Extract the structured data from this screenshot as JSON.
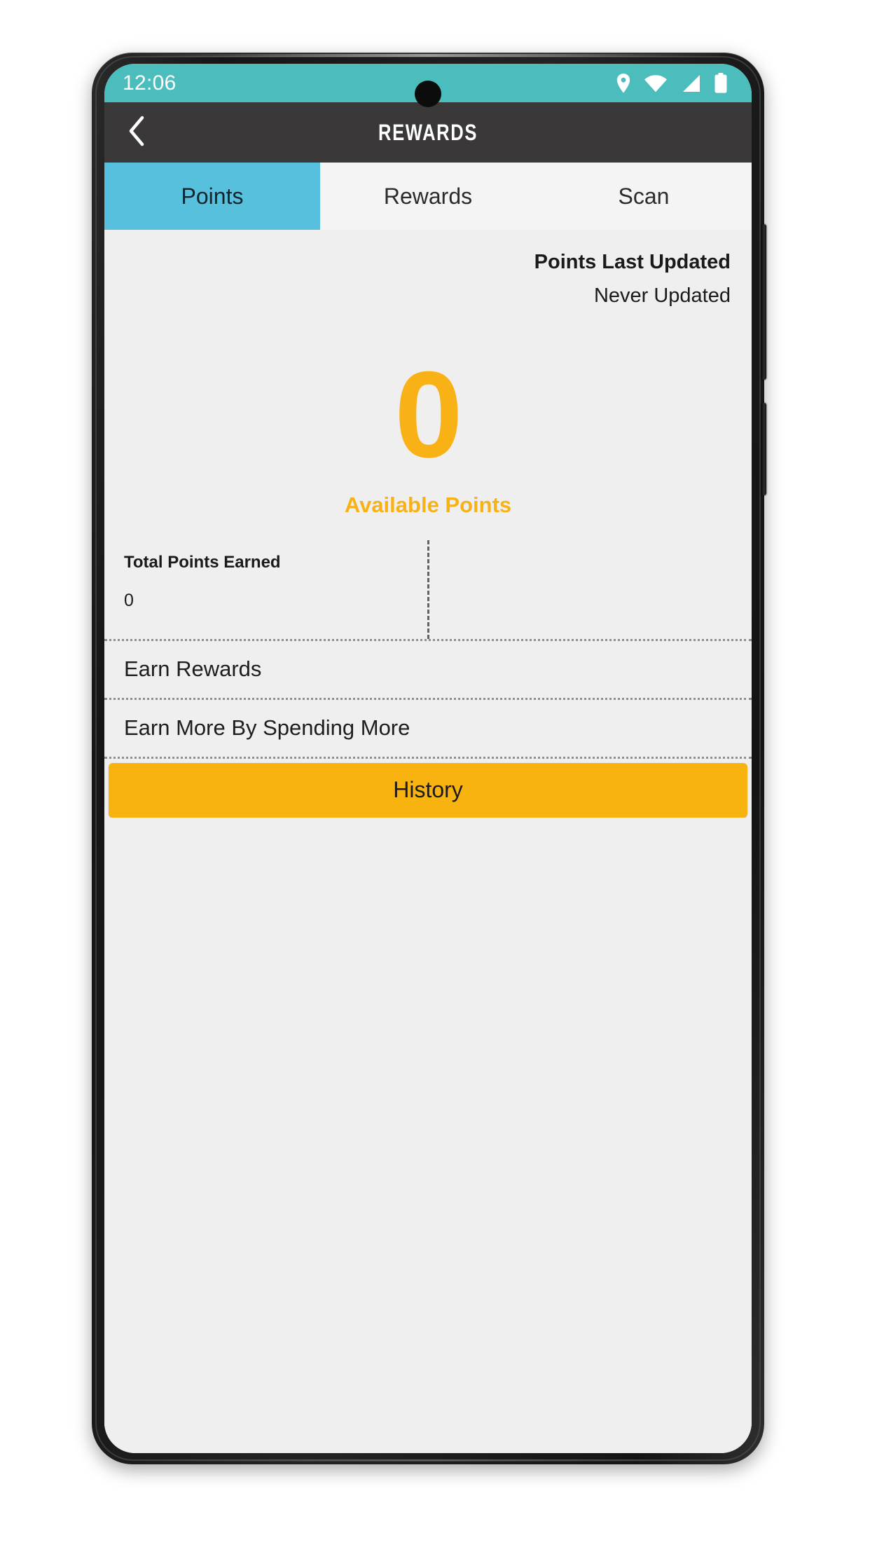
{
  "status_bar": {
    "time": "12:06",
    "background_color": "#4cbdbd",
    "icons": [
      "location-pin-icon",
      "wifi-icon",
      "cellular-signal-icon",
      "battery-icon"
    ]
  },
  "header": {
    "title": "REWARDS",
    "back_icon": "chevron-left-icon",
    "background_color": "#3a3838"
  },
  "tabs": [
    {
      "label": "Points",
      "active": true
    },
    {
      "label": "Rewards",
      "active": false
    },
    {
      "label": "Scan",
      "active": false
    }
  ],
  "active_tab_color": "#57c0dd",
  "accent_color": "#f8b216",
  "points": {
    "last_updated_label": "Points Last Updated",
    "last_updated_value": "Never Updated",
    "available_value": "0",
    "available_label": "Available Points"
  },
  "stats": [
    {
      "label": "Total Points Earned",
      "value": "0"
    },
    {
      "label": "",
      "value": ""
    }
  ],
  "list_rows": [
    {
      "label": "Earn Rewards"
    },
    {
      "label": "Earn More By Spending More"
    }
  ],
  "history_button": {
    "label": "History",
    "color": "#f9b310"
  }
}
